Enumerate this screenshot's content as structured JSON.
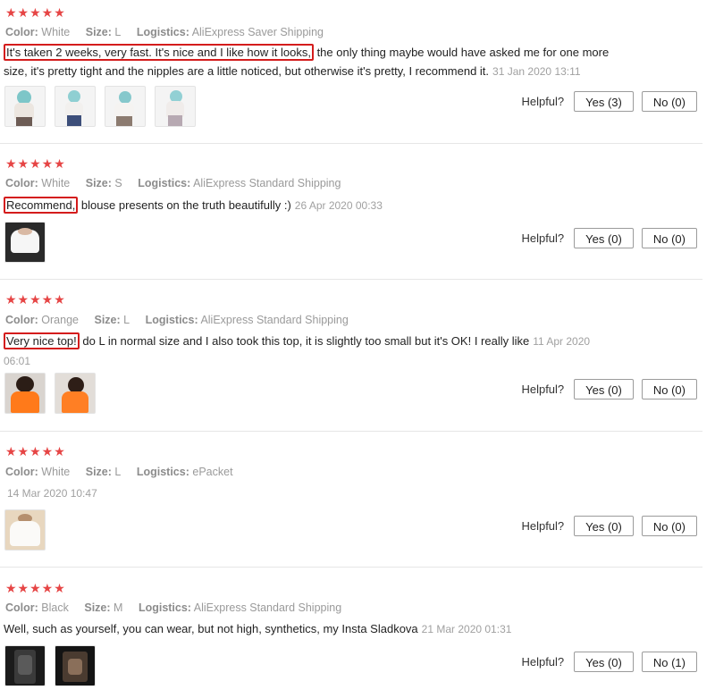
{
  "labels": {
    "color": "Color:",
    "size": "Size:",
    "logistics": "Logistics:",
    "helpful": "Helpful?"
  },
  "star_color": "#e64545",
  "highlight_color": "#d41c1c",
  "reviews": [
    {
      "stars": "★★★★★",
      "color": "White",
      "size": "L",
      "logistics": "AliExpress Saver Shipping",
      "highlight": "It's taken 2 weeks, very fast. It's nice and I like how it looks,",
      "text_line1_rest": " the only thing maybe would have asked me for one more",
      "text_line2": "size, it's pretty tight and the nipples are a little noticed, but otherwise it's pretty, I recommend it.",
      "date": "31 Jan 2020 13:11",
      "yes": "Yes (3)",
      "no": "No (0)"
    },
    {
      "stars": "★★★★★",
      "color": "White",
      "size": "S",
      "logistics": "AliExpress Standard Shipping",
      "highlight": "Recommend,",
      "text_rest": " blouse presents on the truth beautifully :)",
      "date": "26 Apr 2020 00:33",
      "yes": "Yes (0)",
      "no": "No (0)"
    },
    {
      "stars": "★★★★★",
      "color": "Orange",
      "size": "L",
      "logistics": "AliExpress Standard Shipping",
      "highlight": "Very nice top!",
      "text_rest": " do L in normal size and I also took this top, it is slightly too small but it's OK! I really like",
      "date_part1": "11 Apr 2020",
      "date_part2": "06:01",
      "yes": "Yes (0)",
      "no": "No (0)"
    },
    {
      "stars": "★★★★★",
      "color": "White",
      "size": "L",
      "logistics": "ePacket",
      "date": "14 Mar 2020 10:47",
      "yes": "Yes (0)",
      "no": "No (0)"
    },
    {
      "stars": "★★★★★",
      "color": "Black",
      "size": "M",
      "logistics": "AliExpress Standard Shipping",
      "text": "Well, such as yourself, you can wear, but not high, synthetics, my Insta Sladkova",
      "date": "21 Mar 2020 01:31",
      "yes": "Yes (0)",
      "no": "No (1)"
    }
  ]
}
